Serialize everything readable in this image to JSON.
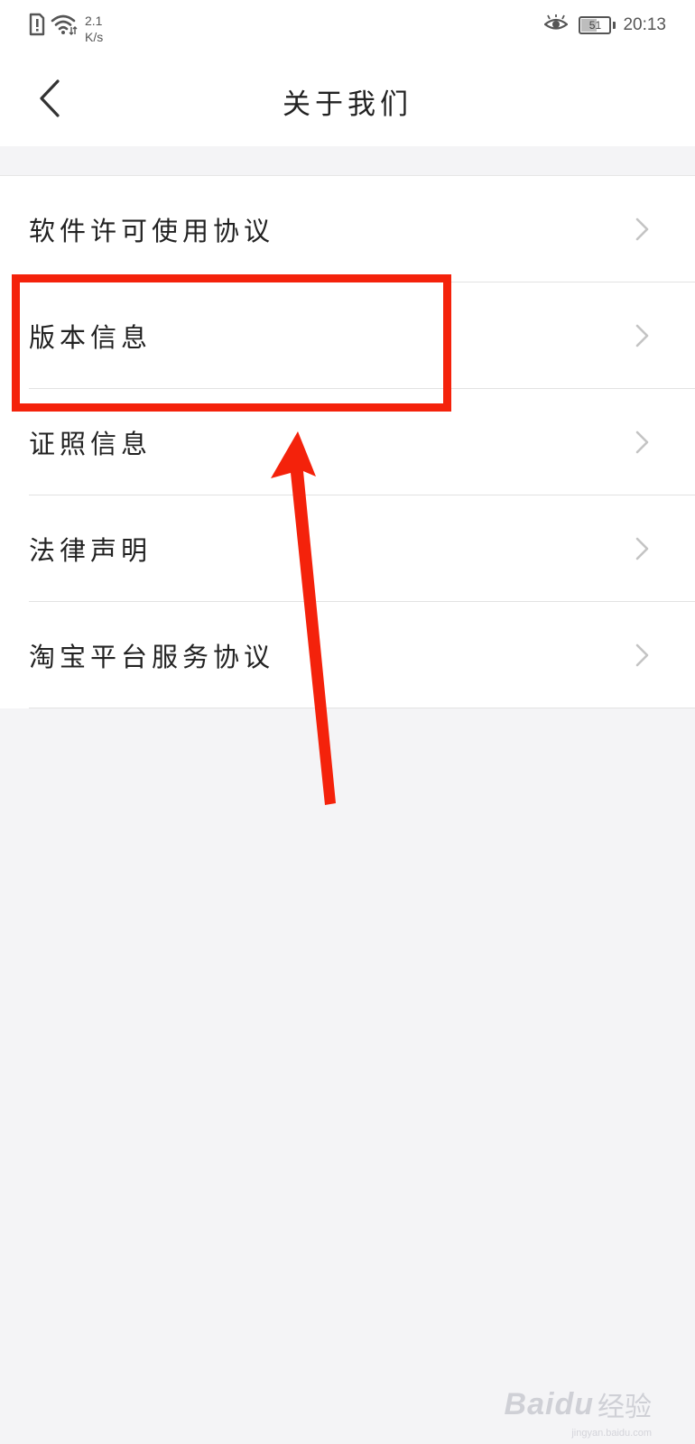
{
  "status_bar": {
    "network_speed_value": "2.1",
    "network_speed_unit": "K/s",
    "battery_level": "51",
    "time": "20:13"
  },
  "nav": {
    "title": "关于我们",
    "back_icon": "chevron-left-icon"
  },
  "menu": {
    "items": [
      {
        "label": "软件许可使用协议"
      },
      {
        "label": "版本信息"
      },
      {
        "label": "证照信息"
      },
      {
        "label": "法律声明"
      },
      {
        "label": "淘宝平台服务协议"
      }
    ],
    "chevron_icon": "chevron-right-icon"
  },
  "annotation": {
    "color": "#f4220b",
    "highlighted_item": "版本信息"
  },
  "watermark": {
    "logo": "Baidu",
    "text": "经验",
    "url": "jingyan.baidu.com"
  },
  "colors": {
    "background": "#f4f4f6",
    "surface": "#ffffff",
    "text": "#222222",
    "divider": "#e2e2e2",
    "chevron": "#c4c4c4"
  }
}
